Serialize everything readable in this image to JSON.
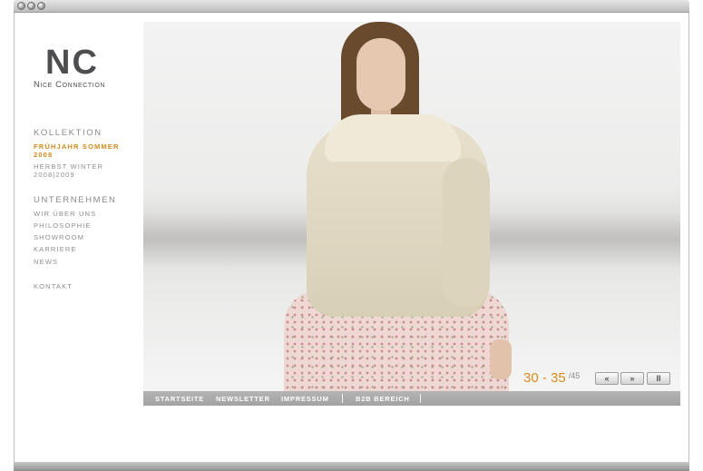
{
  "logo": {
    "mark": "NC",
    "name": "Nice Connection"
  },
  "nav": {
    "kollektion": {
      "heading": "KOLLEKTION",
      "items": [
        {
          "line1": "FRÜHJAHR SOMMER",
          "line2": "2008",
          "active": true
        },
        {
          "line1": "HERBST WINTER",
          "line2": "2008|2009",
          "active": false
        }
      ]
    },
    "unternehmen": {
      "heading": "UNTERNEHMEN",
      "items": [
        "WIR ÜBER UNS",
        "PHILOSOPHIE",
        "SHOWROOM",
        "KARRIERE",
        "NEWS"
      ]
    },
    "kontakt": "KONTAKT"
  },
  "gallery": {
    "range": "30 - 35",
    "total": "/45",
    "controls": {
      "prev": "«",
      "next": "»",
      "pause": "II"
    }
  },
  "footer": {
    "items": [
      "STARTSEITE",
      "NEWSLETTER",
      "IMPRESSUM",
      "B2B BEREICH"
    ]
  },
  "colors": {
    "accent": "#d4891e",
    "nav_text": "#8f8f8f",
    "logo": "#4e4e50",
    "footer_bar": "#ababab"
  }
}
